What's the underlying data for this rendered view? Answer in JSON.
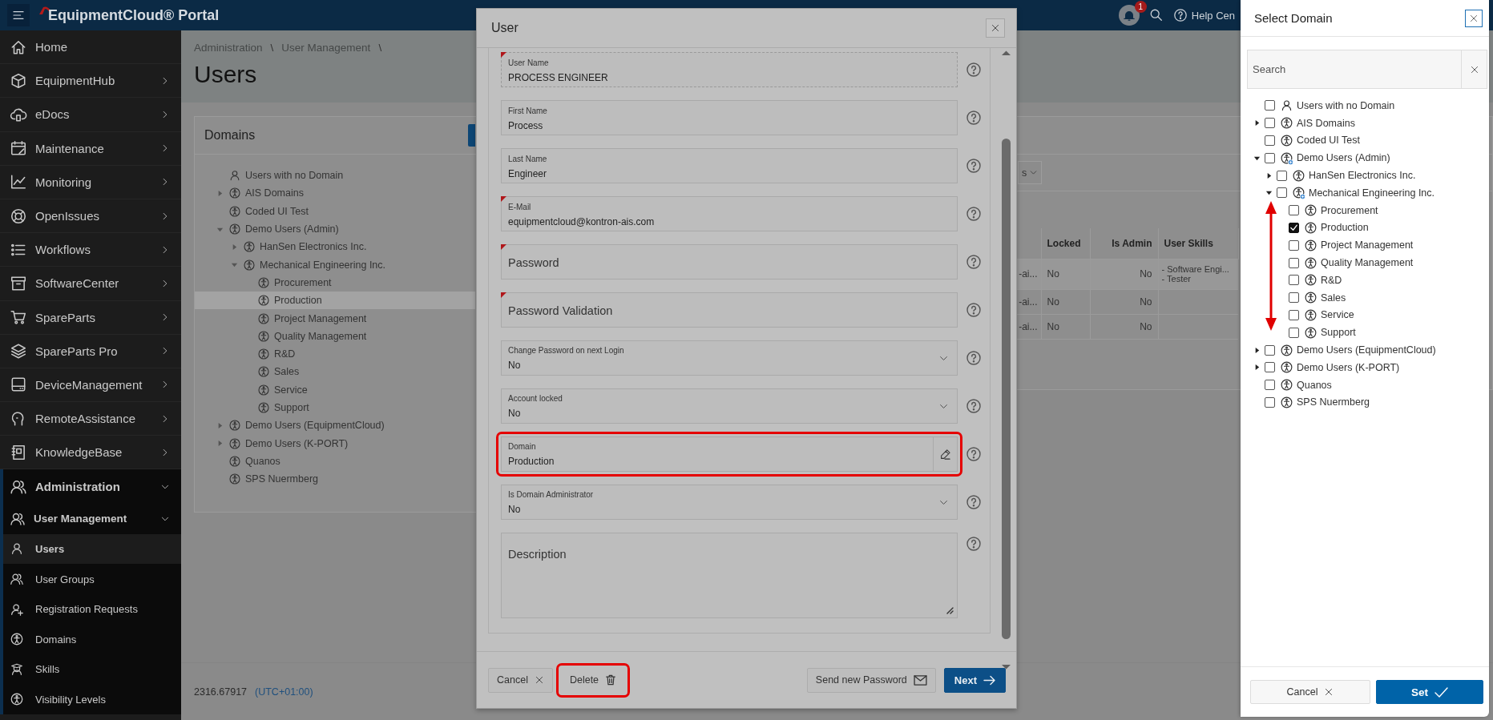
{
  "top_bar": {
    "title": "EquipmentCloud® Portal",
    "notification_count": "1",
    "help_label": "Help Cen"
  },
  "sidebar": {
    "items": [
      {
        "label": "Home"
      },
      {
        "label": "EquipmentHub",
        "expanded": false
      },
      {
        "label": "eDocs",
        "expanded": false
      },
      {
        "label": "Maintenance",
        "expanded": false
      },
      {
        "label": "Monitoring",
        "expanded": false
      },
      {
        "label": "OpenIssues",
        "expanded": false
      },
      {
        "label": "Workflows",
        "expanded": false
      },
      {
        "label": "SoftwareCenter",
        "expanded": false
      },
      {
        "label": "SpareParts",
        "expanded": false
      },
      {
        "label": "SpareParts Pro",
        "expanded": false
      },
      {
        "label": "DeviceManagement",
        "expanded": false
      },
      {
        "label": "RemoteAssistance",
        "expanded": false
      },
      {
        "label": "KnowledgeBase",
        "expanded": false
      },
      {
        "label": "Administration",
        "expanded": true,
        "children": [
          {
            "label": "User Management",
            "expanded": true,
            "children": [
              {
                "label": "Users",
                "selected": true
              },
              {
                "label": "User Groups",
                "selected": false
              },
              {
                "label": "Registration Requests",
                "selected": false
              },
              {
                "label": "Domains",
                "selected": false
              },
              {
                "label": "Skills",
                "selected": false
              },
              {
                "label": "Visibility Levels",
                "selected": false
              }
            ]
          }
        ]
      }
    ]
  },
  "page": {
    "breadcrumb": [
      {
        "kind": "link",
        "text": "Administration"
      },
      {
        "kind": "separator",
        "text": "\\"
      },
      {
        "kind": "link",
        "text": "User Management"
      },
      {
        "kind": "separator",
        "text": "\\"
      }
    ],
    "title": "Users",
    "domains": {
      "title": "Domains",
      "tree": [
        {
          "label": "Users with no Domain",
          "kind": "user",
          "selected": false
        },
        {
          "label": "AIS Domains",
          "kind": "domain",
          "selected": false,
          "expanded": false
        },
        {
          "label": "Coded UI Test",
          "kind": "domain",
          "selected": false
        },
        {
          "label": "Demo Users (Admin)",
          "kind": "domain",
          "selected": false,
          "expanded": true,
          "children": [
            {
              "label": "HanSen Electronics Inc.",
              "kind": "domain",
              "selected": false,
              "expanded": false
            },
            {
              "label": "Mechanical Engineering Inc.",
              "kind": "domain",
              "selected": false,
              "expanded": true,
              "children": [
                {
                  "label": "Procurement",
                  "kind": "domain",
                  "selected": false
                },
                {
                  "label": "Production",
                  "kind": "domain",
                  "selected": true
                },
                {
                  "label": "Project Management",
                  "kind": "domain",
                  "selected": false
                },
                {
                  "label": "Quality Management",
                  "kind": "domain",
                  "selected": false
                },
                {
                  "label": "R&D",
                  "kind": "domain",
                  "selected": false
                },
                {
                  "label": "Sales",
                  "kind": "domain",
                  "selected": false
                },
                {
                  "label": "Service",
                  "kind": "domain",
                  "selected": false
                },
                {
                  "label": "Support",
                  "kind": "domain",
                  "selected": false
                }
              ]
            }
          ]
        },
        {
          "label": "Demo Users (EquipmentCloud)",
          "kind": "domain",
          "selected": false,
          "expanded": false
        },
        {
          "label": "Demo Users (K-PORT)",
          "kind": "domain",
          "selected": false,
          "expanded": false
        },
        {
          "label": "Quanos",
          "kind": "domain",
          "selected": false
        },
        {
          "label": "SPS Nuermberg",
          "kind": "domain",
          "selected": false
        }
      ]
    },
    "users_table": {
      "filter_button": "s",
      "columns": [
        "Locked",
        "Is Admin",
        "User Skills"
      ],
      "rows": [
        {
          "column_1": "-ai...",
          "cells": [
            "No",
            "No"
          ],
          "skills": [
            "- Software Engi...",
            "- Tester"
          ],
          "selected": true
        },
        {
          "column_1": "-ai...",
          "cells": [
            "No",
            "No"
          ],
          "selected": false
        },
        {
          "column_1": "-ai...",
          "cells": [
            "No",
            "No"
          ],
          "selected": false
        }
      ]
    },
    "footer": {
      "version": "2316.67917",
      "timezone": "(UTC+01:00)"
    }
  },
  "modal": {
    "title": "User",
    "fields": [
      {
        "kind": "text",
        "label": "User Name",
        "value": "PROCESS ENGINEER",
        "required": true,
        "readonly": true,
        "highlighted": false
      },
      {
        "kind": "text",
        "label": "First Name",
        "value": "Process",
        "required": false,
        "readonly": false,
        "highlighted": false
      },
      {
        "kind": "text",
        "label": "Last Name",
        "value": "Engineer",
        "required": false,
        "readonly": false,
        "highlighted": false
      },
      {
        "kind": "text",
        "label": "E-Mail",
        "value": "equipmentcloud@kontron-ais.com",
        "required": true,
        "readonly": false,
        "highlighted": false
      },
      {
        "kind": "password",
        "label": "Password",
        "required": true,
        "readonly": false,
        "highlighted": false
      },
      {
        "kind": "password",
        "label": "Password Validation",
        "required": true,
        "readonly": false,
        "highlighted": false
      },
      {
        "kind": "select",
        "label": "Change Password on next Login",
        "value": "No",
        "required": false,
        "readonly": false,
        "highlighted": false
      },
      {
        "kind": "select",
        "label": "Account locked",
        "value": "No",
        "required": false,
        "readonly": false,
        "highlighted": false
      },
      {
        "kind": "picker",
        "label": "Domain",
        "value": "Production",
        "required": false,
        "readonly": false,
        "highlighted": true
      },
      {
        "kind": "select",
        "label": "Is Domain Administrator",
        "value": "No",
        "required": false,
        "readonly": false,
        "highlighted": false
      },
      {
        "kind": "textarea",
        "label": "Description",
        "required": false,
        "readonly": false,
        "highlighted": false
      }
    ],
    "buttons": [
      {
        "kind": "cancel",
        "label": "Cancel",
        "highlighted": false
      },
      {
        "kind": "delete",
        "label": "Delete",
        "highlighted": true
      },
      {
        "kind": "send_password",
        "label": "Send new Password",
        "highlighted": false
      },
      {
        "kind": "next",
        "label": "Next",
        "highlighted": false
      }
    ]
  },
  "domain_panel": {
    "title": "Select Domain",
    "search": {
      "placeholder": "Search"
    },
    "tree": [
      {
        "label": "Users with no Domain",
        "kind": "user",
        "checked": false
      },
      {
        "label": "AIS Domains",
        "kind": "domain",
        "checked": false,
        "expanded": false
      },
      {
        "label": "Coded UI Test",
        "kind": "domain",
        "checked": false
      },
      {
        "label": "Demo Users (Admin)",
        "kind": "admin_domain",
        "checked": false,
        "expanded": true,
        "children": [
          {
            "label": "HanSen Electronics Inc.",
            "kind": "domain",
            "checked": false,
            "expanded": false
          },
          {
            "label": "Mechanical Engineering Inc.",
            "kind": "admin_domain",
            "checked": false,
            "expanded": true,
            "children": [
              {
                "label": "Procurement",
                "kind": "domain",
                "checked": false
              },
              {
                "label": "Production",
                "kind": "domain",
                "checked": true
              },
              {
                "label": "Project Management",
                "kind": "domain",
                "checked": false
              },
              {
                "label": "Quality Management",
                "kind": "domain",
                "checked": false
              },
              {
                "label": "R&D",
                "kind": "domain",
                "checked": false
              },
              {
                "label": "Sales",
                "kind": "domain",
                "checked": false
              },
              {
                "label": "Service",
                "kind": "domain",
                "checked": false
              },
              {
                "label": "Support",
                "kind": "domain",
                "checked": false
              }
            ]
          }
        ]
      },
      {
        "label": "Demo Users (EquipmentCloud)",
        "kind": "domain",
        "checked": false,
        "expanded": false
      },
      {
        "label": "Demo Users (K-PORT)",
        "kind": "domain",
        "checked": false,
        "expanded": false
      },
      {
        "label": "Quanos",
        "kind": "domain",
        "checked": false
      },
      {
        "label": "SPS Nuermberg",
        "kind": "domain",
        "checked": false
      }
    ],
    "annotation": {
      "kind": "double_arrow"
    },
    "buttons": [
      {
        "kind": "cancel",
        "label": "Cancel"
      },
      {
        "kind": "set",
        "label": "Set"
      }
    ]
  }
}
